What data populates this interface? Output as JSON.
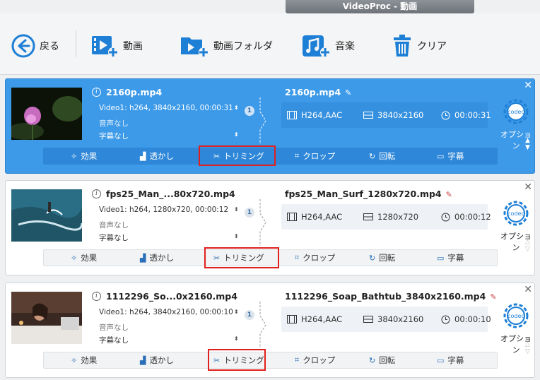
{
  "window": {
    "title": "VideoProc - 動画"
  },
  "toolbar": {
    "back_label": "戻る",
    "video_label": "動画",
    "folder_label": "動画フォルダ",
    "music_label": "音楽",
    "clear_label": "クリア"
  },
  "colors": {
    "accent": "#3d9ae9",
    "toolbar_icon": "#1e7fd6",
    "highlight": "#e0201c"
  },
  "actions": {
    "effect": "効果",
    "watermark": "透かし",
    "trim": "トリミング",
    "crop": "クロップ",
    "rotate": "回転",
    "subtitle": "字幕"
  },
  "option_label": "オプション",
  "codec_label": "codec",
  "items": [
    {
      "selected": true,
      "input_name": "2160p.mp4",
      "video_track": "Video1: h264, 3840x2160, 00:00:31",
      "audio": "音声なし",
      "subtitle": "字幕なし",
      "track_count": "1",
      "output_name": "2160p.mp4",
      "codec": "H264,AAC",
      "resolution": "3840x2160",
      "duration": "00:00:31"
    },
    {
      "selected": false,
      "input_name": "fps25_Man_...80x720.mp4",
      "video_track": "Video1: h264, 1280x720, 00:00:12",
      "audio": "音声なし",
      "subtitle": "字幕なし",
      "track_count": "1",
      "output_name": "fps25_Man_Surf_1280x720.mp4",
      "codec": "H264,AAC",
      "resolution": "1280x720",
      "duration": "00:00:12"
    },
    {
      "selected": false,
      "input_name": "1112296_So...0x2160.mp4",
      "video_track": "Video1: h264, 3840x2160, 00:00:10",
      "audio": "音声なし",
      "subtitle": "字幕なし",
      "track_count": "1",
      "output_name": "1112296_Soap_Bathtub_3840x2160.mp4",
      "codec": "H264,AAC",
      "resolution": "3840x2160",
      "duration": "00:00:10"
    }
  ]
}
